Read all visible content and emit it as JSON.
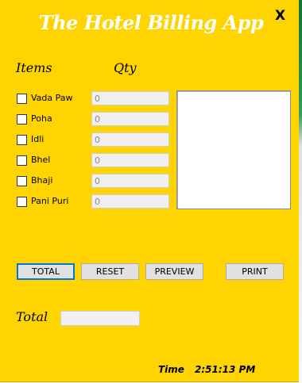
{
  "app": {
    "title": "The Hotel Billing App",
    "close_label": "X"
  },
  "headers": {
    "items": "Items",
    "qty": "Qty"
  },
  "items": [
    {
      "label": "Vada Paw",
      "checked": false,
      "qty": "0"
    },
    {
      "label": "Poha",
      "checked": false,
      "qty": "0"
    },
    {
      "label": "Idli",
      "checked": false,
      "qty": "0"
    },
    {
      "label": "Bhel",
      "checked": false,
      "qty": "0"
    },
    {
      "label": "Bhaji",
      "checked": false,
      "qty": "0"
    },
    {
      "label": "Pani Puri",
      "checked": false,
      "qty": "0"
    }
  ],
  "preview_text": "",
  "buttons": {
    "total": "TOTAL",
    "reset": "RESET",
    "preview": "PREVIEW",
    "print": "PRINT"
  },
  "total": {
    "label": "Total",
    "value": ""
  },
  "clock": {
    "label": "Time",
    "value": "2:51:13 PM"
  },
  "colors": {
    "background": "#ffd400",
    "title": "#ffffff",
    "focus": "#0078d7"
  }
}
